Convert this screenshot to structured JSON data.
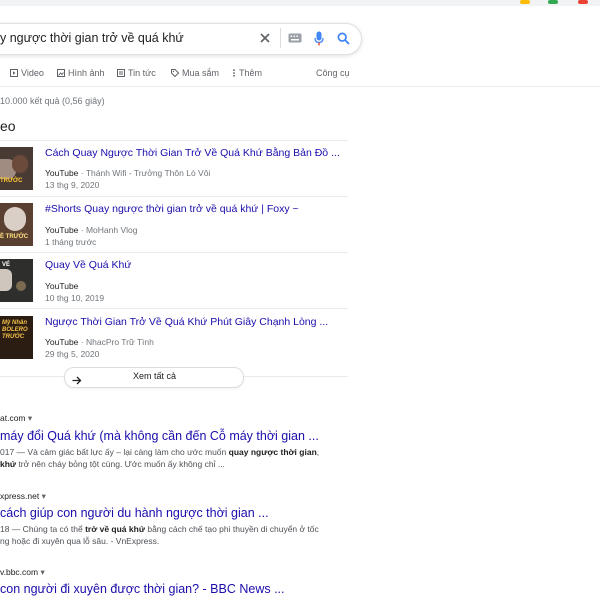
{
  "search": {
    "query": "y ngược thời gian trở về quá khứ"
  },
  "tabs": [
    {
      "label": "Video"
    },
    {
      "label": "Hình ảnh"
    },
    {
      "label": "Tin tức"
    },
    {
      "label": "Mua sắm"
    },
    {
      "label": "Thêm"
    },
    {
      "label": "Công cụ"
    }
  ],
  "stats": "10.000 kết quả (0,56 giây)",
  "video_section": {
    "header": "eo",
    "items": [
      {
        "title": "Cách Quay Ngược Thời Gian Trở Về Quá Khứ Bằng Bản Đồ ...",
        "source": "YouTube",
        "channel": "· Thánh Wifi - Trưởng Thôn Lò Vôi",
        "date": "13 thg 9, 2020",
        "thumb_text": "TRƯỚC"
      },
      {
        "title": "#Shorts Quay ngược thời gian trở về quá khứ | Foxy ~",
        "source": "YouTube",
        "channel": "· MoHanh Vlog",
        "date": "1 tháng trước",
        "thumb_text": "Ề TRƯỚC"
      },
      {
        "title": "Quay Về Quá Khứ",
        "source": "YouTube",
        "channel": "",
        "date": "10 thg 10, 2019",
        "thumb_text": "VÉ"
      },
      {
        "title": "Ngược Thời Gian Trở Về Quá Khứ Phút Giây Chạnh Lòng ...",
        "source": "YouTube",
        "channel": "· NhacPro Trữ Tình",
        "date": "29 thg 5, 2020",
        "thumb_text": "Mỹ Nhân BOLERO TRƯỚC"
      }
    ],
    "see_all": "Xem tất cả"
  },
  "results": [
    {
      "crumb": "at.com",
      "title": "máy đổi Quá khứ (mà không cần đến Cỗ máy thời gian ...",
      "snippet": [
        {
          "pre": "017 — Và cảm giác bất lực ấy – lại càng làm cho ước muốn ",
          "bold": "quay ngược thời gian",
          "post": ","
        },
        {
          "pre": "",
          "bold": "khứ",
          "post": " trở nên cháy bỏng tột cùng. Ước muốn ấy không chỉ ..."
        }
      ]
    },
    {
      "crumb": "xpress.net",
      "title": "cách giúp con người du hành ngược thời gian ...",
      "snippet": [
        {
          "pre": "18 — Chúng ta có thể ",
          "bold": "trở về quá khứ",
          "post": " bằng cách chế tạo phi thuyền di chuyển ở tốc"
        },
        {
          "pre": "ng hoặc đi xuyên qua lỗ sâu. - VnExpress.",
          "bold": "",
          "post": ""
        }
      ]
    },
    {
      "crumb": "v.bbc.com",
      "title": "con người đi xuyên được thời gian? - BBC News ...",
      "snippet": []
    }
  ],
  "colors": {
    "link": "#1a0dab",
    "search_blue": "#4285f4",
    "mic_red": "#ea4335",
    "muted": "#70757a"
  }
}
